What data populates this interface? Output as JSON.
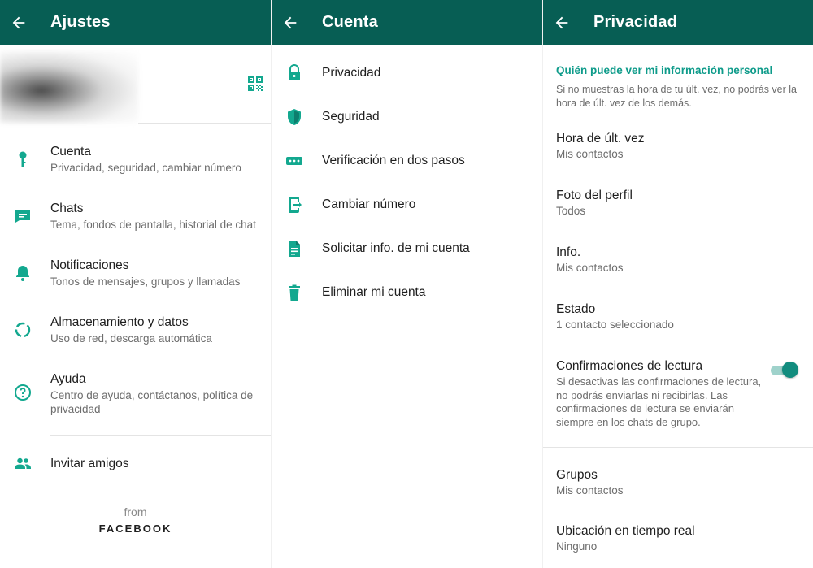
{
  "colors": {
    "appbar": "#075e54",
    "accent": "#128c7e",
    "icon": "#13a88f"
  },
  "settings": {
    "title": "Ajustes",
    "items": [
      {
        "label": "Cuenta",
        "sub": "Privacidad, seguridad, cambiar número",
        "icon": "key-icon"
      },
      {
        "label": "Chats",
        "sub": "Tema, fondos de pantalla, historial de chat",
        "icon": "chat-icon"
      },
      {
        "label": "Notificaciones",
        "sub": "Tonos de mensajes, grupos y llamadas",
        "icon": "bell-icon"
      },
      {
        "label": "Almacenamiento y datos",
        "sub": "Uso de red, descarga automática",
        "icon": "storage-icon"
      },
      {
        "label": "Ayuda",
        "sub": "Centro de ayuda, contáctanos, política de privacidad",
        "icon": "help-icon"
      }
    ],
    "invite": "Invitar amigos",
    "footer_from": "from",
    "footer_brand": "FACEBOOK"
  },
  "account": {
    "title": "Cuenta",
    "items": [
      {
        "label": "Privacidad",
        "icon": "lock-icon"
      },
      {
        "label": "Seguridad",
        "icon": "shield-icon"
      },
      {
        "label": "Verificación en dos pasos",
        "icon": "dots-icon"
      },
      {
        "label": "Cambiar número",
        "icon": "phone-change-icon"
      },
      {
        "label": "Solicitar info. de mi cuenta",
        "icon": "document-icon"
      },
      {
        "label": "Eliminar mi cuenta",
        "icon": "trash-icon"
      }
    ]
  },
  "privacy": {
    "title": "Privacidad",
    "section_title": "Quién puede ver mi información personal",
    "section_desc": "Si no muestras la hora de tu últ. vez, no podrás ver la hora de últ. vez de los demás.",
    "items": [
      {
        "label": "Hora de últ. vez",
        "value": "Mis contactos"
      },
      {
        "label": "Foto del perfil",
        "value": "Todos"
      },
      {
        "label": "Info.",
        "value": "Mis contactos"
      },
      {
        "label": "Estado",
        "value": "1 contacto seleccionado"
      }
    ],
    "read_receipts": {
      "label": "Confirmaciones de lectura",
      "desc": "Si desactivas las confirmaciones de lectura, no podrás enviarlas ni recibirlas. Las confirmaciones de lectura se enviarán siempre en los chats de grupo.",
      "enabled": true
    },
    "groups": {
      "label": "Grupos",
      "value": "Mis contactos"
    },
    "live_location": {
      "label": "Ubicación en tiempo real",
      "value": "Ninguno"
    }
  }
}
